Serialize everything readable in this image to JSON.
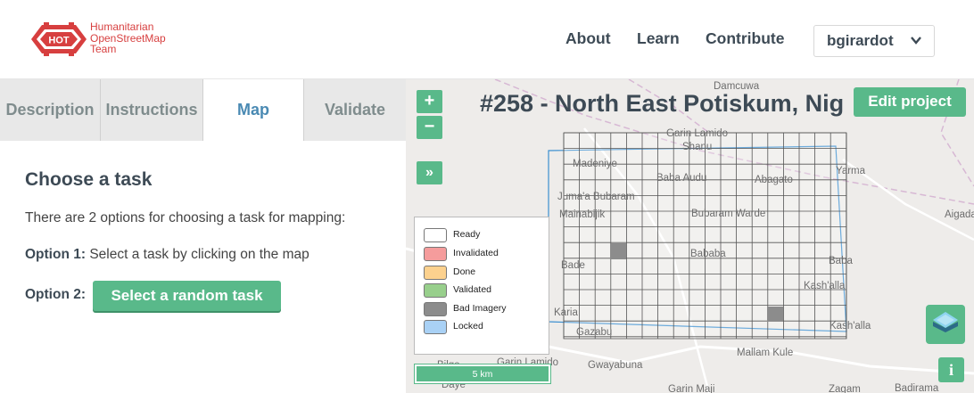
{
  "brand": {
    "line1": "Humanitarian",
    "line2": "OpenStreetMap",
    "line3": "Team",
    "badge": "HOT",
    "color": "#d73f3f"
  },
  "nav": {
    "about": "About",
    "learn": "Learn",
    "contribute": "Contribute",
    "user": "bgirardot",
    "user_icon": "chevron-down-icon"
  },
  "tabs": [
    {
      "label": "Description",
      "active": false
    },
    {
      "label": "Instructions",
      "active": false
    },
    {
      "label": "Map",
      "active": true
    },
    {
      "label": "Validate",
      "active": false
    }
  ],
  "panel": {
    "title": "Choose a task",
    "intro": "There are 2 options for choosing a task for mapping:",
    "option1_label": "Option 1:",
    "option1_text": "Select a task by clicking on the map",
    "option2_label": "Option 2:",
    "random_button": "Select a random task"
  },
  "map": {
    "title": "#258 - North East Potiskum, Nig",
    "edit_button": "Edit project",
    "zoom_in": "+",
    "zoom_out": "−",
    "expand": "»",
    "info": "i",
    "scale": "5 km",
    "layers_icon": "layers-icon",
    "places": [
      "Damcuwa",
      "Garin Lamido",
      "Shanu",
      "Madeniye",
      "Baba Audu",
      "Abagato",
      "Yarma",
      "Juma'a Bubaram",
      "Bubaram Warde",
      "Aigada",
      "Mainabijik",
      "Bababa",
      "Bade",
      "Baba",
      "Kash'alla",
      "Karia",
      "Gazabu",
      "Kash'alla",
      "Mallam Kule",
      "Garin Lamido",
      "Gwayabuna",
      "Bilgo",
      "Daye",
      "Garin Maji",
      "Zagam",
      "Badirama"
    ]
  },
  "legend": [
    {
      "label": "Ready",
      "color": "#ffffff"
    },
    {
      "label": "Invalidated",
      "color": "#f59c9c"
    },
    {
      "label": "Done",
      "color": "#fcd18e"
    },
    {
      "label": "Validated",
      "color": "#98cf8c"
    },
    {
      "label": "Bad Imagery",
      "color": "#8c8c8c"
    },
    {
      "label": "Locked",
      "color": "#a9d1f5"
    }
  ],
  "colors": {
    "accent": "#59b98a",
    "nav_text": "#3d4a55",
    "tab_active": "#4a8ab3"
  }
}
